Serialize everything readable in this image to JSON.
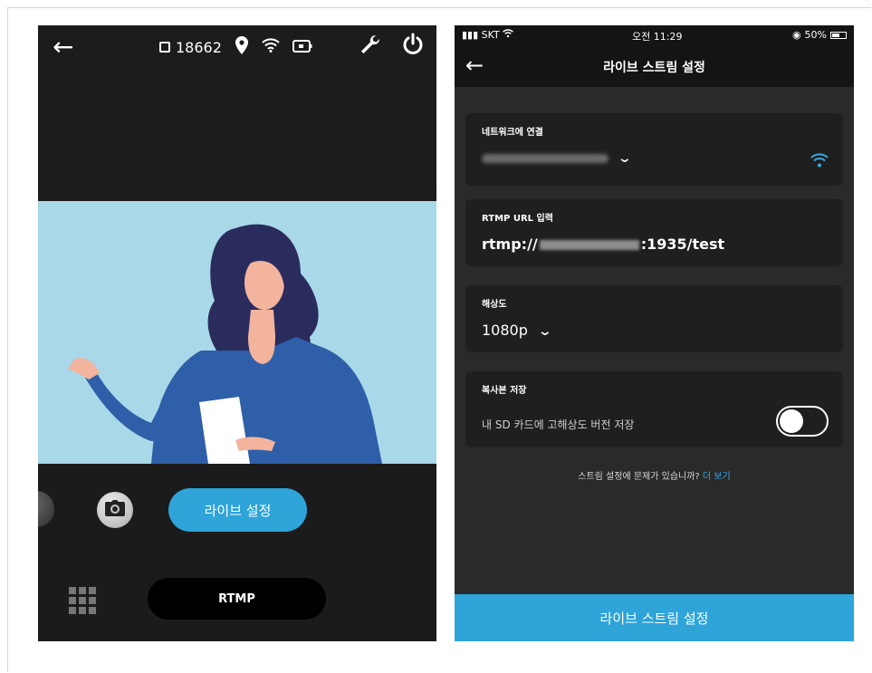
{
  "camera_screen": {
    "storage_count": "18662",
    "icons": {
      "back": "arrow-left-icon",
      "storage": "sd-card-icon",
      "location": "location-pin-icon",
      "wifi": "wifi-icon",
      "battery": "battery-icon",
      "settings": "wrench-icon",
      "power": "power-icon",
      "camera": "camera-icon",
      "grid": "grid-icon"
    },
    "live_settings_button": "라이브 설정",
    "mode_button": "RTMP"
  },
  "settings_screen": {
    "status_bar": {
      "carrier": "SKT",
      "time": "오전 11:29",
      "battery": "50%"
    },
    "title": "라이브 스트림 설정",
    "network": {
      "label": "네트워크에 연결"
    },
    "rtmp": {
      "label": "RTMP URL 입력",
      "prefix": "rtmp://",
      "suffix": ":1935/test"
    },
    "resolution": {
      "label": "해상도",
      "value": "1080p"
    },
    "copy": {
      "label": "복사본 저장",
      "description": "내 SD 카드에 고해상도 버전 저장",
      "enabled": false
    },
    "help": {
      "text": "스트림 설정에 문제가 있습니까?",
      "link": "더 보기"
    },
    "bottom_button": "라이브 스트림 설정"
  },
  "colors": {
    "accent": "#2ea4d9",
    "sky": "#a9d8e8",
    "shirt": "#2f5fa8",
    "hair": "#2a2c5e",
    "skin": "#f3b49e"
  }
}
